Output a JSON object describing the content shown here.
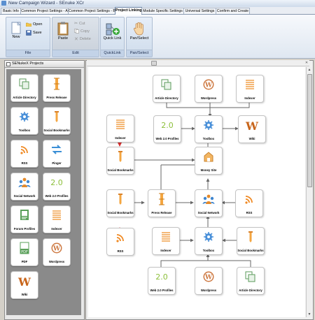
{
  "window": {
    "title": "New Campaign Wizard - SEnuke XCr"
  },
  "tabs": [
    "Basic Info",
    "Common Project Settings - A",
    "Common Project Settings - B",
    "Project Linking",
    "Module Specific Settings",
    "Universal Settings",
    "Confirm and Create"
  ],
  "active_tab": "Project Linking",
  "ribbon": {
    "file": {
      "label": "File",
      "new": "New",
      "open": "Open",
      "save": "Save"
    },
    "edit": {
      "label": "Edit",
      "paste": "Paste",
      "cut": "Cut",
      "copy": "Copy",
      "delete": "Delete"
    },
    "quicklink": {
      "label": "QuickLink",
      "button": "Quick Link"
    },
    "panselect": {
      "label": "Pan/Select",
      "button": "Pan/Select"
    }
  },
  "left_panel": {
    "title": "SENukeX Projects",
    "items": [
      {
        "label": "Article Directory",
        "icon": "article-directory-icon"
      },
      {
        "label": "Press Release",
        "icon": "press-release-icon"
      },
      {
        "label": "Toolbox",
        "icon": "toolbox-icon"
      },
      {
        "label": "Social Bookmarks",
        "icon": "social-bookmarks-icon"
      },
      {
        "label": "RSS",
        "icon": "rss-icon"
      },
      {
        "label": "Pinger",
        "icon": "pinger-icon"
      },
      {
        "label": "Social Network",
        "icon": "social-network-icon"
      },
      {
        "label": "Web 2.0 Profiles",
        "icon": "web20-icon"
      },
      {
        "label": "Forum Profiles",
        "icon": "forum-profiles-icon"
      },
      {
        "label": "Indexer",
        "icon": "indexer-icon"
      },
      {
        "label": "PDF",
        "icon": "pdf-icon"
      },
      {
        "label": "Wordpress",
        "icon": "wordpress-icon"
      },
      {
        "label": "Wiki",
        "icon": "wiki-icon"
      }
    ]
  },
  "canvas": {
    "nodes": [
      {
        "label": "Article Directory",
        "icon": "article-directory-icon"
      },
      {
        "label": "Wordpress",
        "icon": "wordpress-icon"
      },
      {
        "label": "Indexer",
        "icon": "indexer-icon"
      },
      {
        "label": "Indexer",
        "icon": "indexer-icon"
      },
      {
        "label": "Web 2.0 Profiles",
        "icon": "web20-icon"
      },
      {
        "label": "Toolbox",
        "icon": "toolbox-icon"
      },
      {
        "label": "Wiki",
        "icon": "wiki-icon"
      },
      {
        "label": "Social Bookmarks",
        "icon": "social-bookmarks-icon"
      },
      {
        "label": "Money Site",
        "icon": "money-site-icon"
      },
      {
        "label": "Social Bookmarks",
        "icon": "social-bookmarks-icon"
      },
      {
        "label": "Press Release",
        "icon": "press-release-icon"
      },
      {
        "label": "Social Network",
        "icon": "social-network-icon"
      },
      {
        "label": "RSS",
        "icon": "rss-icon"
      },
      {
        "label": "RSS",
        "icon": "rss-icon"
      },
      {
        "label": "Indexer",
        "icon": "indexer-icon"
      },
      {
        "label": "Toolbox",
        "icon": "toolbox-icon"
      },
      {
        "label": "Social Bookmarks",
        "icon": "social-bookmarks-icon"
      },
      {
        "label": "Web 2.0 Profiles",
        "icon": "web20-icon"
      },
      {
        "label": "Wordpress",
        "icon": "wordpress-icon"
      },
      {
        "label": "Article Directory",
        "icon": "article-directory-icon"
      }
    ]
  },
  "colors": {
    "canvas_bg": "#ffffff",
    "palette_bg": "#8a8a8a",
    "link": "#666666",
    "red_link": "#d83030",
    "ribbon_group": "#cfdcec"
  }
}
